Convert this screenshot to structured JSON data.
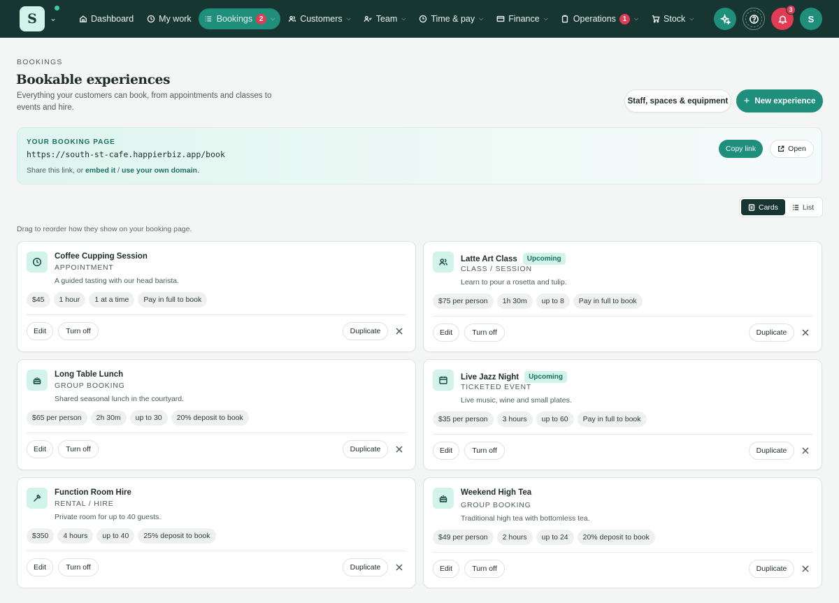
{
  "nav": {
    "logo_letter": "S",
    "items": [
      {
        "label": "Dashboard",
        "icon": "home-icon"
      },
      {
        "label": "My work",
        "icon": "clock-icon"
      },
      {
        "label": "Bookings",
        "icon": "list-icon",
        "badge": "2",
        "active": true
      },
      {
        "label": "Customers",
        "icon": "users-icon"
      },
      {
        "label": "Team",
        "icon": "team-icon"
      },
      {
        "label": "Time & pay",
        "icon": "timer-icon"
      },
      {
        "label": "Finance",
        "icon": "card-icon"
      },
      {
        "label": "Operations",
        "icon": "clipboard-icon",
        "badge": "1"
      },
      {
        "label": "Stock",
        "icon": "cart-icon"
      }
    ],
    "notifications_count": "3",
    "user_initial": "S"
  },
  "header": {
    "kicker": "BOOKINGS",
    "title": "Bookable experiences",
    "subtitle": "Everything your customers can book, from appointments and classes to events and hire.",
    "staff_button": "Staff, spaces & equipment",
    "new_button": "New experience"
  },
  "booking_page": {
    "kicker": "YOUR BOOKING PAGE",
    "url": "https://south-st-cafe.happierbiz.app/book",
    "share_prefix": "Share this link, or ",
    "embed_link": "embed it",
    "share_sep": " / ",
    "domain_link": "use your own domain",
    "share_suffix": ".",
    "copy_button": "Copy link",
    "open_button": "Open"
  },
  "view_toggle": {
    "cards": "Cards",
    "list": "List"
  },
  "drag_hint": "Drag to reorder how they show on your booking page.",
  "card_actions": {
    "edit": "Edit",
    "turn_off": "Turn off",
    "duplicate": "Duplicate"
  },
  "experiences": [
    {
      "name": "Coffee Cupping Session",
      "type": "APPOINTMENT",
      "description": "A guided tasting with our head barista.",
      "icon": "clock-icon",
      "tag": "",
      "chips": [
        "$45",
        "1 hour",
        "1 at a time",
        "Pay in full to book"
      ]
    },
    {
      "name": "Latte Art Class",
      "type": "CLASS / SESSION",
      "description": "Learn to pour a rosetta and tulip.",
      "icon": "users-icon",
      "tag": "Upcoming",
      "chips": [
        "$75 per person",
        "1h 30m",
        "up to 8",
        "Pay in full to book"
      ]
    },
    {
      "name": "Long Table Lunch",
      "type": "GROUP BOOKING",
      "description": "Shared seasonal lunch in the courtyard.",
      "icon": "cake-icon",
      "tag": "",
      "chips": [
        "$65 per person",
        "2h 30m",
        "up to 30",
        "20% deposit to book"
      ]
    },
    {
      "name": "Live Jazz Night",
      "type": "TICKETED EVENT",
      "description": "Live music, wine and small plates.",
      "icon": "calendar-icon",
      "tag": "Upcoming",
      "chips": [
        "$35 per person",
        "3 hours",
        "up to 60",
        "Pay in full to book"
      ]
    },
    {
      "name": "Function Room Hire",
      "type": "RENTAL / HIRE",
      "description": "Private room for up to 40 guests.",
      "icon": "hammer-icon",
      "tag": "",
      "chips": [
        "$350",
        "4 hours",
        "up to 40",
        "25% deposit to book"
      ]
    },
    {
      "name": "Weekend High Tea",
      "type": "GROUP BOOKING",
      "description": "Traditional high tea with bottomless tea.",
      "icon": "cake-icon",
      "tag": "",
      "chips": [
        "$49 per person",
        "2 hours",
        "up to 24",
        "20% deposit to book"
      ]
    }
  ]
}
